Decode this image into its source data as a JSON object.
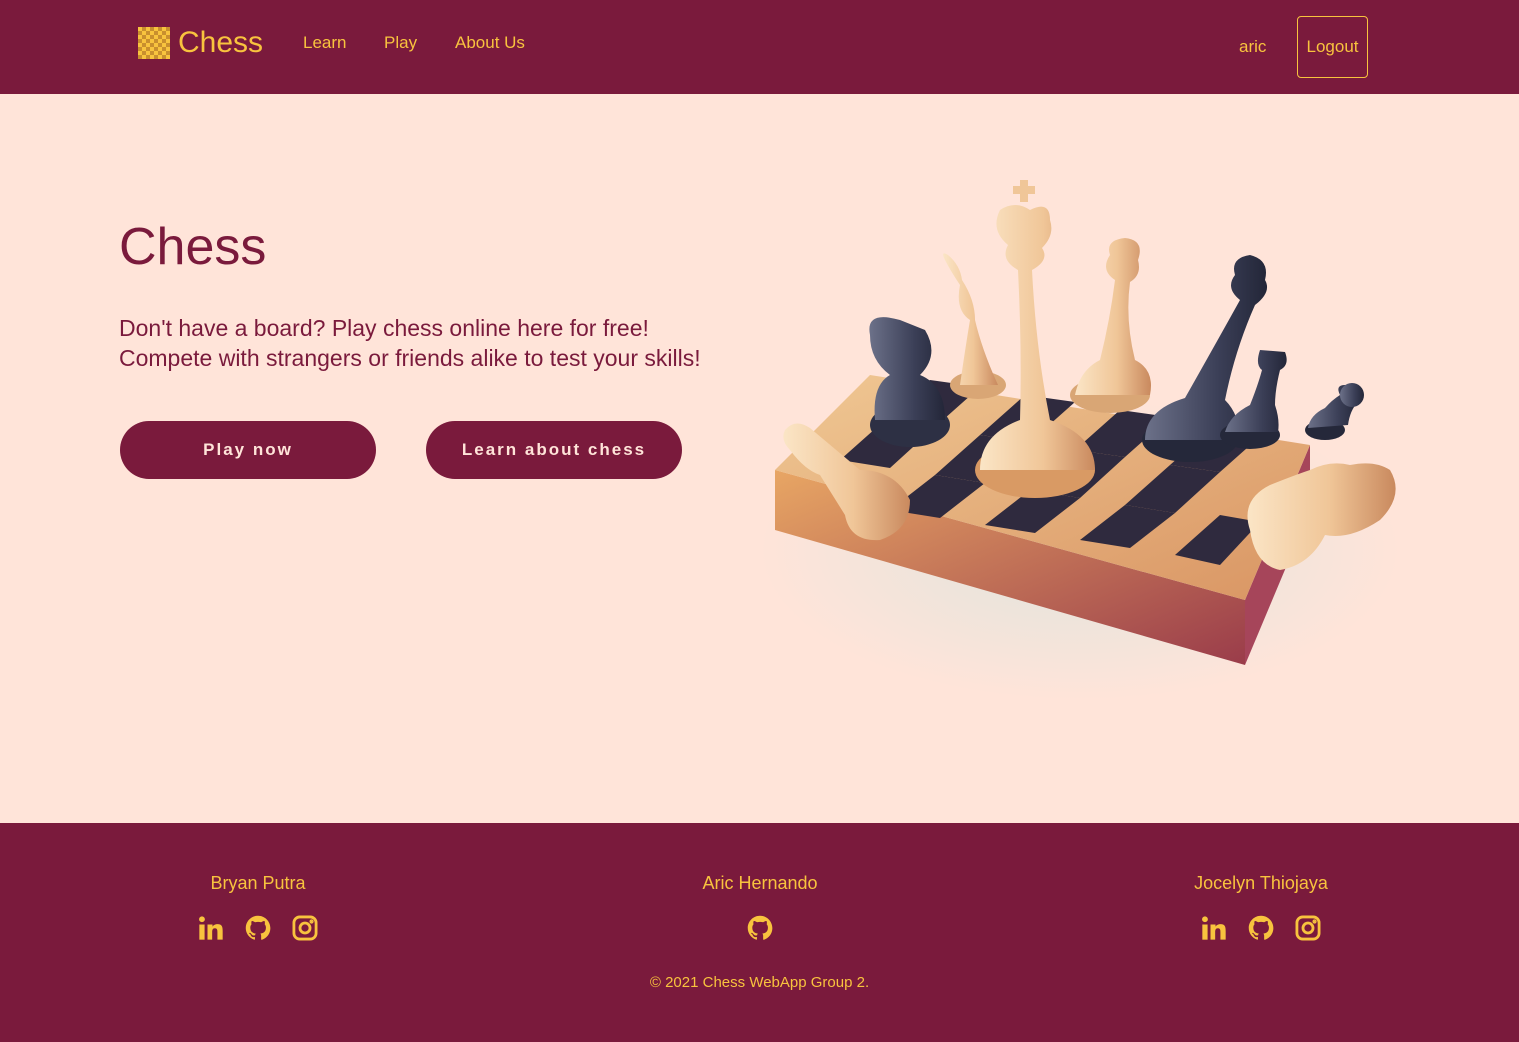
{
  "nav": {
    "brand": "Chess",
    "links": [
      "Learn",
      "Play",
      "About Us"
    ],
    "user": "aric",
    "logout": "Logout"
  },
  "hero": {
    "title": "Chess",
    "line1": "Don't have a board? Play chess online here for free!",
    "line2": "Compete with strangers or friends alike to test your skills!",
    "play_button": "Play now",
    "learn_button": "Learn about chess"
  },
  "footer": {
    "members": [
      {
        "name": "Bryan Putra",
        "socials": [
          "linkedin-icon",
          "github-icon",
          "instagram-icon"
        ]
      },
      {
        "name": "Aric Hernando",
        "socials": [
          "github-icon"
        ]
      },
      {
        "name": "Jocelyn Thiojaya",
        "socials": [
          "linkedin-icon",
          "github-icon",
          "instagram-icon"
        ]
      }
    ],
    "copyright": "© 2021 Chess WebApp Group 2."
  },
  "colors": {
    "primary": "#7a1a3c",
    "accent": "#f8c33e",
    "background": "#ffe4d9"
  }
}
